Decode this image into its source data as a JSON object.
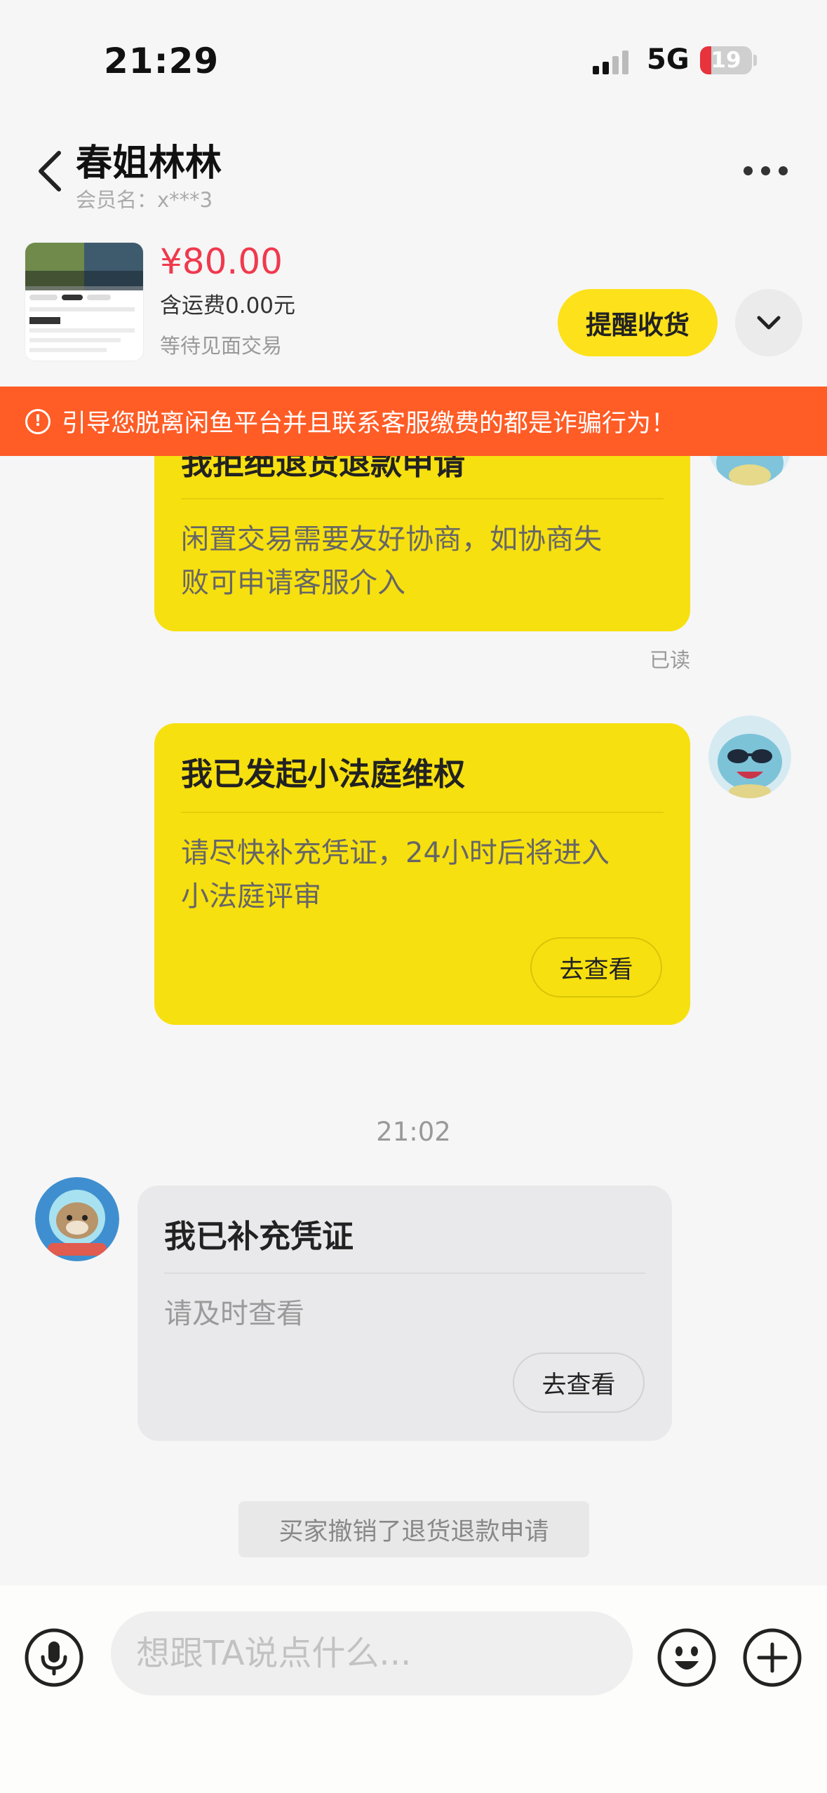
{
  "status_bar": {
    "time": "21:29",
    "network": "5G",
    "battery": "19"
  },
  "header": {
    "title": "春姐林林",
    "member_label": "会员名：x***3"
  },
  "product": {
    "price": "¥80.00",
    "shipping": "含运费0.00元",
    "status": "等待见面交易",
    "remind_button": "提醒收货"
  },
  "warning": {
    "text": "引导您脱离闲鱼平台并且联系客服缴费的都是诈骗行为！"
  },
  "messages": {
    "refuse_card": {
      "title": "我拒绝退货退款申请",
      "body_line1": "闲置交易需要友好协商，如协商失",
      "body_line2": "败可申请客服介入",
      "read": "已读"
    },
    "court_card": {
      "title": "我已发起小法庭维权",
      "body_line1": "请尽快补充凭证，24小时后将进入",
      "body_line2": "小法庭评审",
      "button": "去查看"
    },
    "timestamp": "21:02",
    "evidence_card": {
      "title": "我已补充凭证",
      "body": "请及时查看",
      "button": "去查看"
    },
    "system_notice": "买家撤销了退货退款申请"
  },
  "input": {
    "placeholder": "想跟TA说点什么..."
  },
  "colors": {
    "accent_yellow": "#f7e00f",
    "price_red": "#f0394d",
    "warning_orange": "#ff5c26"
  }
}
